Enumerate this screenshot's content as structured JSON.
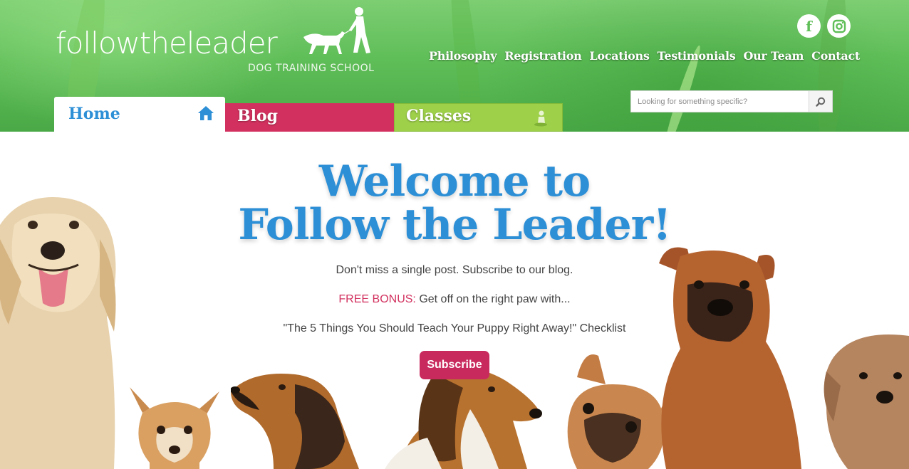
{
  "logo": {
    "wordmark": "followtheleader",
    "tagline": "DOG TRAINING SCHOOL"
  },
  "social": {
    "facebook_icon": "facebook-icon",
    "instagram_icon": "instagram-icon"
  },
  "nav": {
    "items": [
      "Philosophy",
      "Registration",
      "Locations",
      "Testimonials",
      "Our Team",
      "Contact"
    ]
  },
  "search": {
    "placeholder": "Looking for something specific?",
    "button_icon": "search-icon"
  },
  "tabs": [
    {
      "label": "Home",
      "icon": "home-icon"
    },
    {
      "label": "Blog"
    },
    {
      "label": "Classes",
      "icon": "trainer-icon"
    }
  ],
  "hero": {
    "title_line1": "Welcome to",
    "title_line2": "Follow the Leader!",
    "subscribe_prompt": "Don't miss a single post. Subscribe to our blog.",
    "bonus_label": "FREE BONUS:",
    "bonus_text": " Get off on the right paw with...",
    "checklist_text": "\"The 5 Things You Should Teach Your Puppy Right Away!\" Checklist",
    "subscribe_button": "Subscribe"
  },
  "colors": {
    "accent_blue": "#2d8fd6",
    "blog_pink": "#d2315f",
    "classes_green": "#9ed04a",
    "subscribe_magenta": "#c92a5e"
  }
}
